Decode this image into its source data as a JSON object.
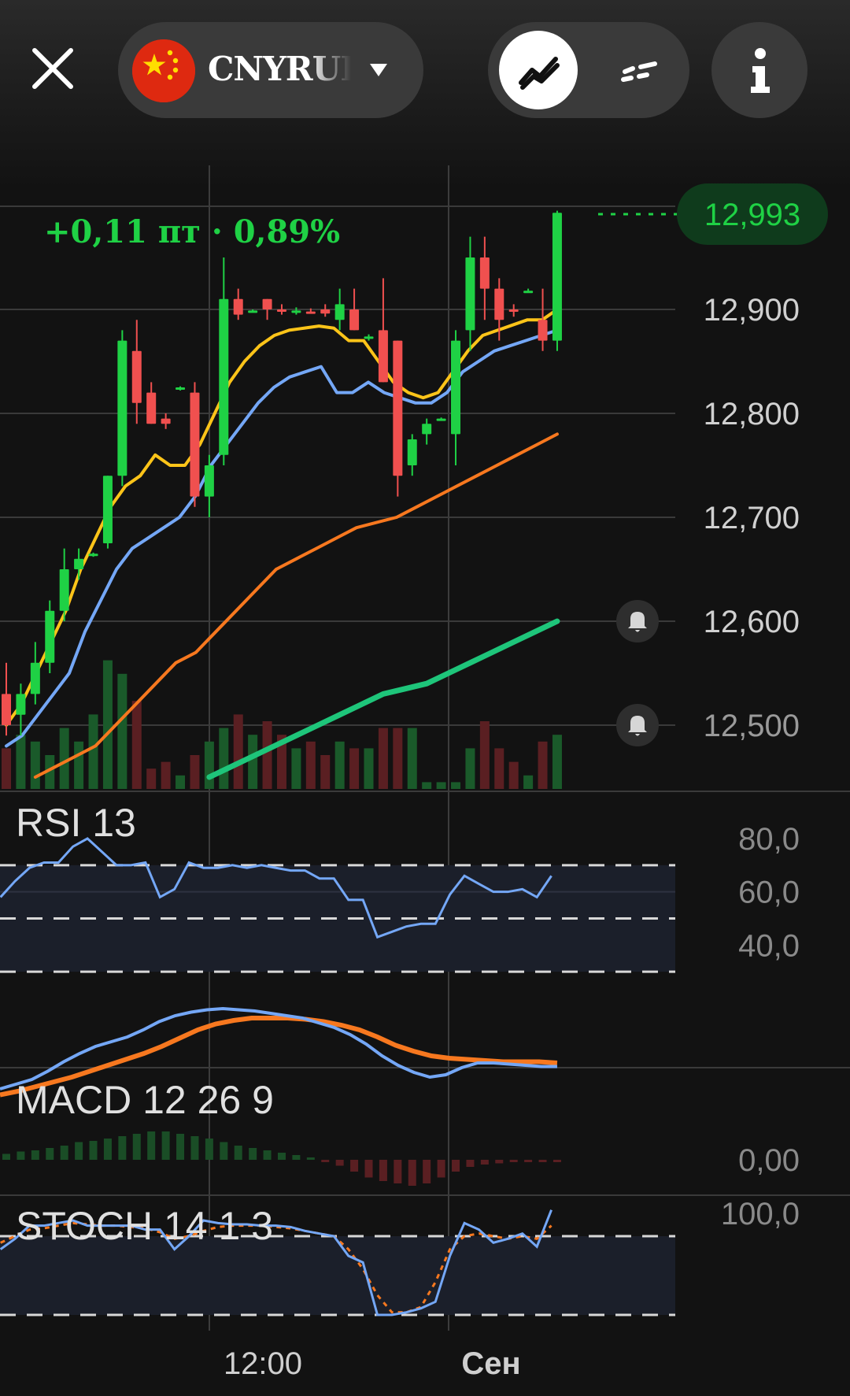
{
  "header": {
    "ticker": "CNYRUB",
    "close_icon": "close-icon",
    "flag_icon": "china-flag-icon",
    "dropdown_icon": "caret-down-icon",
    "mode_line_icon": "line-chart-icon",
    "mode_dash_icon": "dashed-line-icon",
    "info_icon": "info-icon"
  },
  "colors": {
    "up": "#1fd145",
    "down": "#f0504f",
    "ema_fast": "#fcc419",
    "ema_mid": "#74a7f6",
    "ema_slow": "#f7781f",
    "ema_long": "#1ec57a",
    "price_badge": "#0f3b1c"
  },
  "chart_data": {
    "type": "candlestick",
    "change_label": "+0,11 пт · 0,89%",
    "last_price": "12,993",
    "price_axis": {
      "ticks": [
        "12,900",
        "12,800",
        "12,700",
        "12,600",
        "12,500"
      ],
      "values": [
        12.9,
        12.8,
        12.7,
        12.6,
        12.5
      ]
    },
    "time_axis": {
      "labels": [
        "12:00",
        "Сен"
      ]
    },
    "alerts": [
      12.6,
      12.5
    ],
    "candles": [
      {
        "o": 12.53,
        "h": 12.56,
        "l": 12.49,
        "c": 12.5
      },
      {
        "o": 12.51,
        "h": 12.54,
        "l": 12.49,
        "c": 12.53
      },
      {
        "o": 12.53,
        "h": 12.58,
        "l": 12.52,
        "c": 12.56
      },
      {
        "o": 12.56,
        "h": 12.62,
        "l": 12.55,
        "c": 12.61
      },
      {
        "o": 12.61,
        "h": 12.67,
        "l": 12.6,
        "c": 12.65
      },
      {
        "o": 12.65,
        "h": 12.67,
        "l": 12.64,
        "c": 12.66
      },
      {
        "o": 12.664,
        "h": 12.666,
        "l": 12.662,
        "c": 12.665
      },
      {
        "o": 12.675,
        "h": 12.74,
        "l": 12.67,
        "c": 12.74
      },
      {
        "o": 12.74,
        "h": 12.88,
        "l": 12.73,
        "c": 12.87
      },
      {
        "o": 12.86,
        "h": 12.89,
        "l": 12.79,
        "c": 12.81
      },
      {
        "o": 12.82,
        "h": 12.83,
        "l": 12.79,
        "c": 12.79
      },
      {
        "o": 12.795,
        "h": 12.8,
        "l": 12.785,
        "c": 12.79
      },
      {
        "o": 12.824,
        "h": 12.826,
        "l": 12.822,
        "c": 12.825
      },
      {
        "o": 12.82,
        "h": 12.83,
        "l": 12.71,
        "c": 12.72
      },
      {
        "o": 12.72,
        "h": 12.76,
        "l": 12.7,
        "c": 12.75
      },
      {
        "o": 12.76,
        "h": 12.95,
        "l": 12.75,
        "c": 12.91
      },
      {
        "o": 12.91,
        "h": 12.92,
        "l": 12.89,
        "c": 12.895
      },
      {
        "o": 12.898,
        "h": 12.9,
        "l": 12.897,
        "c": 12.899
      },
      {
        "o": 12.91,
        "h": 12.91,
        "l": 12.89,
        "c": 12.9
      },
      {
        "o": 12.9,
        "h": 12.905,
        "l": 12.895,
        "c": 12.898
      },
      {
        "o": 12.898,
        "h": 12.902,
        "l": 12.895,
        "c": 12.899
      },
      {
        "o": 12.898,
        "h": 12.901,
        "l": 12.896,
        "c": 12.897
      },
      {
        "o": 12.9,
        "h": 12.905,
        "l": 12.893,
        "c": 12.896
      },
      {
        "o": 12.89,
        "h": 12.92,
        "l": 12.88,
        "c": 12.905
      },
      {
        "o": 12.9,
        "h": 12.92,
        "l": 12.88,
        "c": 12.88
      },
      {
        "o": 12.872,
        "h": 12.876,
        "l": 12.87,
        "c": 12.874
      },
      {
        "o": 12.88,
        "h": 12.93,
        "l": 12.83,
        "c": 12.83
      },
      {
        "o": 12.87,
        "h": 12.87,
        "l": 12.72,
        "c": 12.74
      },
      {
        "o": 12.75,
        "h": 12.78,
        "l": 12.74,
        "c": 12.775
      },
      {
        "o": 12.78,
        "h": 12.795,
        "l": 12.77,
        "c": 12.79
      },
      {
        "o": 12.794,
        "h": 12.796,
        "l": 12.793,
        "c": 12.795
      },
      {
        "o": 12.78,
        "h": 12.88,
        "l": 12.75,
        "c": 12.87
      },
      {
        "o": 12.88,
        "h": 12.97,
        "l": 12.86,
        "c": 12.95
      },
      {
        "o": 12.95,
        "h": 12.97,
        "l": 12.89,
        "c": 12.92
      },
      {
        "o": 12.92,
        "h": 12.93,
        "l": 12.87,
        "c": 12.89
      },
      {
        "o": 12.9,
        "h": 12.905,
        "l": 12.893,
        "c": 12.898
      },
      {
        "o": 12.918,
        "h": 12.92,
        "l": 12.916,
        "c": 12.918
      },
      {
        "o": 12.89,
        "h": 12.92,
        "l": 12.86,
        "c": 12.87
      },
      {
        "o": 12.87,
        "h": 12.995,
        "l": 12.86,
        "c": 12.993
      }
    ],
    "ema_fast": [
      12.5,
      12.52,
      12.55,
      12.58,
      12.61,
      12.65,
      12.68,
      12.71,
      12.73,
      12.74,
      12.76,
      12.75,
      12.75,
      12.77,
      12.8,
      12.83,
      12.85,
      12.865,
      12.875,
      12.88,
      12.882,
      12.884,
      12.882,
      12.87,
      12.87,
      12.85,
      12.83,
      12.82,
      12.815,
      12.82,
      12.84,
      12.86,
      12.875,
      12.88,
      12.885,
      12.89,
      12.89,
      12.9
    ],
    "ema_mid": [
      12.48,
      12.49,
      12.51,
      12.53,
      12.55,
      12.59,
      12.62,
      12.65,
      12.67,
      12.68,
      12.69,
      12.7,
      12.72,
      12.75,
      12.77,
      12.79,
      12.81,
      12.825,
      12.835,
      12.84,
      12.845,
      12.82,
      12.82,
      12.83,
      12.82,
      12.815,
      12.81,
      12.81,
      12.82,
      12.84,
      12.85,
      12.86,
      12.865,
      12.87,
      12.875,
      12.88
    ],
    "ema_slow": [
      12.45,
      12.46,
      12.47,
      12.48,
      12.5,
      12.52,
      12.54,
      12.56,
      12.57,
      12.59,
      12.61,
      12.63,
      12.65,
      12.66,
      12.67,
      12.68,
      12.69,
      12.695,
      12.7,
      12.71,
      12.72,
      12.73,
      12.74,
      12.75,
      12.76,
      12.77,
      12.78
    ],
    "ema_long": [
      12.45,
      12.46,
      12.47,
      12.48,
      12.49,
      12.5,
      12.51,
      12.52,
      12.53,
      12.535,
      12.54,
      12.55,
      12.56,
      12.57,
      12.58,
      12.59,
      12.6
    ],
    "volume": [
      30,
      40,
      35,
      25,
      45,
      35,
      55,
      95,
      85,
      65,
      15,
      20,
      10,
      25,
      35,
      45,
      55,
      40,
      50,
      40,
      30,
      35,
      25,
      35,
      30,
      30,
      45,
      45,
      45,
      5,
      5,
      5,
      30,
      50,
      30,
      20,
      10,
      35,
      40
    ],
    "rsi": {
      "label": "RSI 13",
      "ticks": [
        "80,0",
        "60,0",
        "40,0"
      ],
      "tick_values": [
        80,
        60,
        40
      ],
      "levels": [
        70,
        50,
        30
      ],
      "values": [
        58,
        64,
        69,
        71,
        71,
        77,
        80,
        75,
        70,
        70,
        71,
        58,
        61,
        71,
        69,
        69,
        70,
        69,
        70,
        69,
        68,
        68,
        65,
        65,
        57,
        57,
        43,
        45,
        47,
        48,
        48,
        59,
        66,
        63,
        60,
        60,
        61,
        58,
        66
      ]
    },
    "macd": {
      "label": "MACD 12 26 9",
      "zero_tick": "0,00",
      "macd_line": [
        0.06,
        0.064,
        0.068,
        0.075,
        0.083,
        0.09,
        0.096,
        0.1,
        0.104,
        0.11,
        0.117,
        0.122,
        0.125,
        0.127,
        0.128,
        0.127,
        0.126,
        0.124,
        0.122,
        0.12,
        0.116,
        0.112,
        0.106,
        0.098,
        0.088,
        0.08,
        0.074,
        0.07,
        0.072,
        0.078,
        0.082,
        0.082,
        0.081,
        0.08,
        0.079,
        0.079
      ],
      "signal_line": [
        0.055,
        0.058,
        0.062,
        0.066,
        0.07,
        0.075,
        0.08,
        0.085,
        0.09,
        0.096,
        0.103,
        0.11,
        0.115,
        0.118,
        0.12,
        0.12,
        0.12,
        0.119,
        0.117,
        0.114,
        0.11,
        0.104,
        0.097,
        0.092,
        0.088,
        0.086,
        0.085,
        0.084,
        0.083,
        0.083,
        0.083,
        0.082
      ],
      "histogram": [
        0.005,
        0.007,
        0.008,
        0.01,
        0.012,
        0.015,
        0.016,
        0.018,
        0.02,
        0.022,
        0.024,
        0.024,
        0.022,
        0.02,
        0.018,
        0.015,
        0.012,
        0.01,
        0.008,
        0.006,
        0.004,
        0.002,
        -0.002,
        -0.005,
        -0.01,
        -0.015,
        -0.018,
        -0.02,
        -0.022,
        -0.02,
        -0.015,
        -0.01,
        -0.006,
        -0.004,
        -0.003,
        -0.002,
        -0.002,
        -0.002,
        -0.002
      ]
    },
    "stoch": {
      "label": "STOCH 14 1 3",
      "ticks": [
        "100,0"
      ],
      "tick_values": [
        100
      ],
      "levels": [
        80,
        20
      ],
      "k": [
        70,
        78,
        88,
        88,
        90,
        92,
        88,
        88,
        88,
        88,
        85,
        85,
        70,
        80,
        92,
        90,
        89,
        89,
        88,
        88,
        87,
        84,
        82,
        80,
        65,
        60,
        20,
        20,
        22,
        25,
        30,
        65,
        90,
        85,
        75,
        78,
        82,
        72,
        100
      ],
      "d": [
        75,
        80,
        85,
        86,
        88,
        90,
        89,
        88,
        88,
        87,
        86,
        83,
        78,
        80,
        84,
        87,
        88,
        88,
        88,
        87,
        86,
        84,
        82,
        80,
        70,
        55,
        35,
        22,
        22,
        26,
        45,
        70,
        80,
        82,
        80,
        78,
        80,
        78,
        88
      ]
    }
  }
}
